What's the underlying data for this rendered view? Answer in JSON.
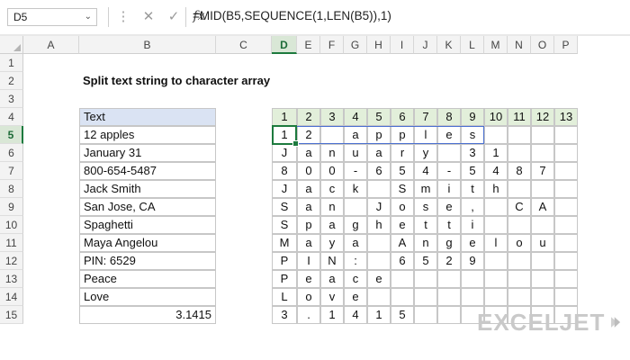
{
  "formula_bar": {
    "name_box": "D5",
    "name_box_arrow": "⌄",
    "icons": [
      "more-vertical-icon",
      "cancel-icon",
      "enter-check-icon",
      "function-icon"
    ],
    "icon_glyphs": [
      "⋮",
      "✕",
      "✓",
      "fx"
    ],
    "formula": "=MID(B5,SEQUENCE(1,LEN(B5)),1)"
  },
  "columns": [
    "A",
    "B",
    "C",
    "D",
    "E",
    "F",
    "G",
    "H",
    "I",
    "J",
    "K",
    "L",
    "M",
    "N",
    "O",
    "P"
  ],
  "rows": [
    "1",
    "2",
    "3",
    "4",
    "5",
    "6",
    "7",
    "8",
    "9",
    "10",
    "11",
    "12",
    "13",
    "14",
    "15"
  ],
  "selected_column": "D",
  "selected_row": "5",
  "title": "Split text string to character array",
  "text_table": {
    "header": "Text",
    "values": [
      "12 apples",
      "January 31",
      "800-654-5487",
      "Jack Smith",
      "San Jose, CA",
      "Spaghetti",
      "Maya Angelou",
      "PIN: 6529",
      "Peace",
      "Love",
      "3.1415"
    ]
  },
  "output_table": {
    "header": [
      "1",
      "2",
      "3",
      "4",
      "5",
      "6",
      "7",
      "8",
      "9",
      "10",
      "11",
      "12",
      "13"
    ],
    "rows": [
      [
        "1",
        "2",
        "",
        "a",
        "p",
        "p",
        "l",
        "e",
        "s",
        "",
        "",
        "",
        ""
      ],
      [
        "J",
        "a",
        "n",
        "u",
        "a",
        "r",
        "y",
        "",
        "3",
        "1",
        "",
        "",
        ""
      ],
      [
        "8",
        "0",
        "0",
        "-",
        "6",
        "5",
        "4",
        "-",
        "5",
        "4",
        "8",
        "7",
        ""
      ],
      [
        "J",
        "a",
        "c",
        "k",
        "",
        "S",
        "m",
        "i",
        "t",
        "h",
        "",
        "",
        ""
      ],
      [
        "S",
        "a",
        "n",
        "",
        "J",
        "o",
        "s",
        "e",
        ",",
        "",
        "C",
        "A",
        ""
      ],
      [
        "S",
        "p",
        "a",
        "g",
        "h",
        "e",
        "t",
        "t",
        "i",
        "",
        "",
        "",
        ""
      ],
      [
        "M",
        "a",
        "y",
        "a",
        "",
        "A",
        "n",
        "g",
        "e",
        "l",
        "o",
        "u",
        ""
      ],
      [
        "P",
        "I",
        "N",
        ":",
        "",
        "6",
        "5",
        "2",
        "9",
        "",
        "",
        "",
        ""
      ],
      [
        "P",
        "e",
        "a",
        "c",
        "e",
        "",
        "",
        "",
        "",
        "",
        "",
        "",
        ""
      ],
      [
        "L",
        "o",
        "v",
        "e",
        "",
        "",
        "",
        "",
        "",
        "",
        "",
        "",
        ""
      ],
      [
        "3",
        ".",
        "1",
        "4",
        "1",
        "5",
        "",
        "",
        "",
        "",
        "",
        "",
        ""
      ]
    ]
  },
  "logo": {
    "text": "EXCELJET"
  }
}
